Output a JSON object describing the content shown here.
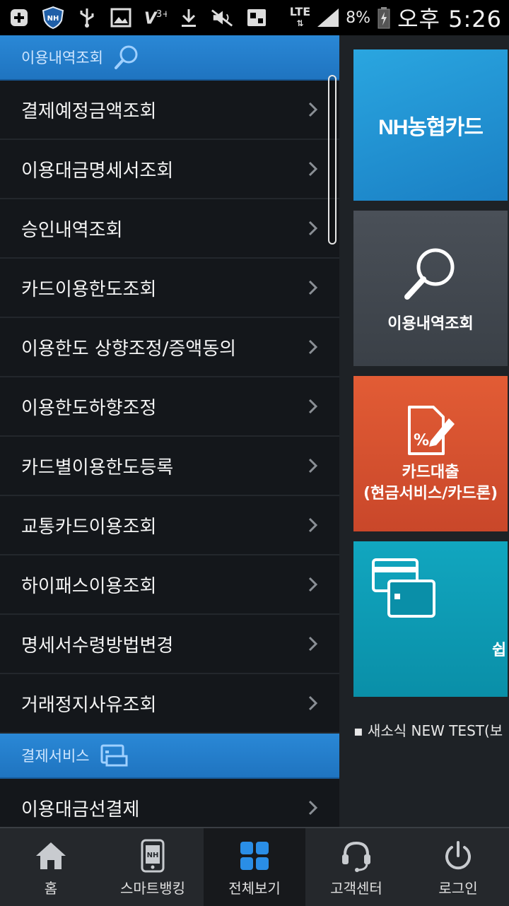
{
  "statusbar": {
    "network": "LTE",
    "battery": "8%",
    "time": "오후 5:26",
    "nh_badge": "NH"
  },
  "menu": {
    "section1": {
      "label": "이용내역조회",
      "icon": "search-icon"
    },
    "items1": [
      "결제예정금액조회",
      "이용대금명세서조회",
      "승인내역조회",
      "카드이용한도조회",
      "이용한도 상향조정/증액동의",
      "이용한도하향조정",
      "카드별이용한도등록",
      "교통카드이용조회",
      "하이패스이용조회",
      "명세서수령방법변경",
      "거래정지사유조회"
    ],
    "section2": {
      "label": "결제서비스",
      "icon": "payment-icon"
    },
    "items2": [
      "이용대금선결제"
    ]
  },
  "right": {
    "nh_card_logo": "NH농협카드",
    "tile_search_label": "이용내역조회",
    "tile_loan_percent": "%",
    "tile_loan_line1": "카드대출",
    "tile_loan_line2": "(현금서비스/카드론)",
    "tile_card_partial": "쉽",
    "news": "새소식 NEW TEST(보"
  },
  "bottomnav": [
    {
      "label": "홈",
      "icon": "home-icon"
    },
    {
      "label": "스마트뱅킹",
      "icon": "smartphone-icon",
      "badge": "NH"
    },
    {
      "label": "전체보기",
      "icon": "grid-icon"
    },
    {
      "label": "고객센터",
      "icon": "headset-icon"
    },
    {
      "label": "로그인",
      "icon": "power-icon"
    }
  ],
  "colors": {
    "accent_blue": "#2a88d6",
    "nh_tile": "#1a7fc4",
    "loan_tile": "#d9522f",
    "card_tile": "#0e9cb5",
    "grid_icon": "#2a8ee6"
  }
}
